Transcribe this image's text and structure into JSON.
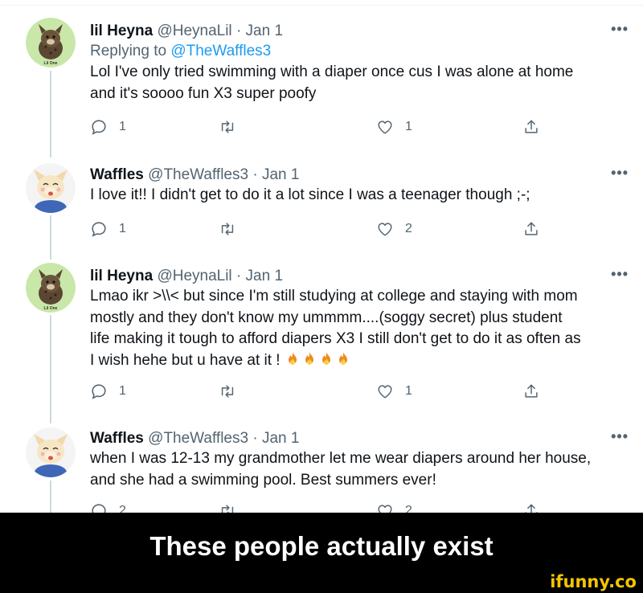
{
  "tweets": [
    {
      "name": "lil Heyna",
      "handle": "@HeynaLil",
      "sep": "·",
      "date": "Jan 1",
      "replying_prefix": "Replying to",
      "replying_to": "@TheWaffles3",
      "body": [
        "Lol I've only tried swimming with a diaper once cus I was alone at home",
        "and it's soooo fun X3 super poofy"
      ],
      "replies": "1",
      "retweets": "",
      "likes": "1",
      "avatar_label": "Lil One",
      "more": "•••"
    },
    {
      "name": "Waffles",
      "handle": "@TheWaffles3",
      "sep": "·",
      "date": "Jan 1",
      "body": [
        "I love it!! I didn't get to do it a lot since I was a teenager though ;-;"
      ],
      "replies": "1",
      "retweets": "",
      "likes": "2",
      "more": "•••"
    },
    {
      "name": "lil Heyna",
      "handle": "@HeynaLil",
      "sep": "·",
      "date": "Jan 1",
      "body": [
        "Lmao ikr >\\\\< but since I'm still studying at college and staying with mom",
        "mostly and they don't know my ummmm....(soggy secret) plus student",
        "life making it tough to afford diapers X3 I still don't get to do it as often as",
        "I wish hehe but u have at it !"
      ],
      "emoji_count": 4,
      "emoji_name": "fire-emoji",
      "replies": "1",
      "retweets": "",
      "likes": "1",
      "avatar_label": "Lil One",
      "more": "•••"
    },
    {
      "name": "Waffles",
      "handle": "@TheWaffles3",
      "sep": "·",
      "date": "Jan 1",
      "body": [
        "when I was 12-13 my grandmother let me wear diapers around her house,",
        "and she had a swimming pool. Best summers ever!"
      ],
      "replies": "2",
      "retweets": "",
      "likes": "2",
      "more": "•••"
    }
  ],
  "icons": {
    "reply": "reply-icon",
    "retweet": "retweet-icon",
    "like": "heart-icon",
    "share": "share-icon",
    "more": "more-icon"
  },
  "caption": "These people actually exist",
  "watermark": "ifunny.co",
  "colors": {
    "text": "#0f1419",
    "muted": "#536471",
    "link": "#1d9bf0",
    "thread_line": "#cfd9de",
    "caption_bg": "#000000",
    "caption_text": "#ffffff",
    "watermark": "#f5c400"
  }
}
